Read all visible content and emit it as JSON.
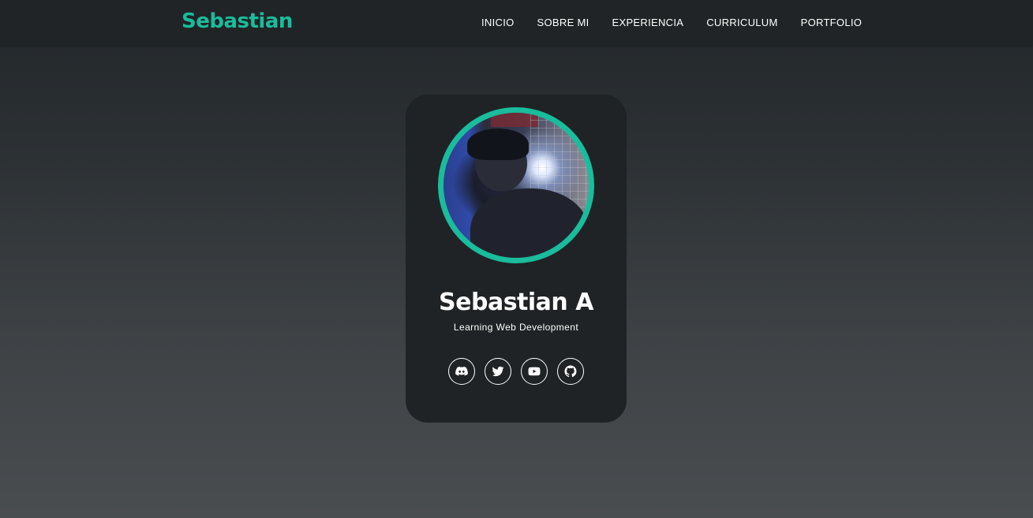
{
  "navbar": {
    "brand": "Sebastian",
    "links": [
      {
        "label": "INICIO"
      },
      {
        "label": "SOBRE MI"
      },
      {
        "label": "EXPERIENCIA"
      },
      {
        "label": "CURRICULUM"
      },
      {
        "label": "PORTFOLIO"
      }
    ]
  },
  "profile": {
    "name": "Sebastian A",
    "tagline": "Learning Web Development",
    "socials": [
      {
        "icon": "discord-icon"
      },
      {
        "icon": "twitter-icon"
      },
      {
        "icon": "youtube-icon"
      },
      {
        "icon": "github-icon"
      }
    ]
  },
  "colors": {
    "accent": "#1abc9c",
    "navbar_bg": "#202426",
    "card_bg": "#1f2325",
    "text": "#ffffff"
  }
}
